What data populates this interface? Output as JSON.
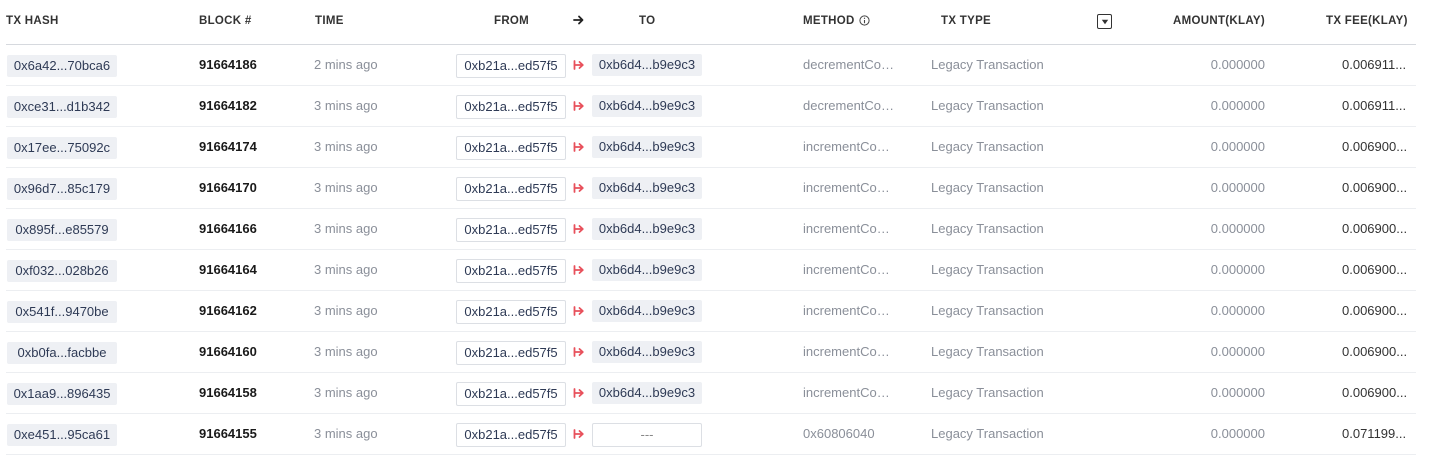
{
  "columns": {
    "tx_hash": "TX HASH",
    "block": "BLOCK #",
    "time": "TIME",
    "from": "FROM",
    "to": "TO",
    "method": "METHOD",
    "tx_type": "TX TYPE",
    "amount": "AMOUNT(KLAY)",
    "tx_fee": "TX FEE(KLAY)"
  },
  "icons": {
    "header_arrow": "arrow-right-icon",
    "method_info": "info-icon",
    "filter": "filter-dropdown-icon",
    "row_arrow": "transfer-arrow-icon"
  },
  "colors": {
    "row_arrow": "#e8505b",
    "chip_bg": "#eef0f4"
  },
  "rows": [
    {
      "hash": "0x6a42...70bca6",
      "block": "91664186",
      "time": "2 mins ago",
      "from": "0xb21a...ed57f5",
      "to": "0xb6d4...b9e9c3",
      "method": "decrementCounter",
      "tx_type": "Legacy Transaction",
      "amount": "0.000000",
      "fee": "0.006911..."
    },
    {
      "hash": "0xce31...d1b342",
      "block": "91664182",
      "time": "3 mins ago",
      "from": "0xb21a...ed57f5",
      "to": "0xb6d4...b9e9c3",
      "method": "decrementCounter",
      "tx_type": "Legacy Transaction",
      "amount": "0.000000",
      "fee": "0.006911..."
    },
    {
      "hash": "0x17ee...75092c",
      "block": "91664174",
      "time": "3 mins ago",
      "from": "0xb21a...ed57f5",
      "to": "0xb6d4...b9e9c3",
      "method": "incrementCounter",
      "tx_type": "Legacy Transaction",
      "amount": "0.000000",
      "fee": "0.006900..."
    },
    {
      "hash": "0x96d7...85c179",
      "block": "91664170",
      "time": "3 mins ago",
      "from": "0xb21a...ed57f5",
      "to": "0xb6d4...b9e9c3",
      "method": "incrementCounter",
      "tx_type": "Legacy Transaction",
      "amount": "0.000000",
      "fee": "0.006900..."
    },
    {
      "hash": "0x895f...e85579",
      "block": "91664166",
      "time": "3 mins ago",
      "from": "0xb21a...ed57f5",
      "to": "0xb6d4...b9e9c3",
      "method": "incrementCounter",
      "tx_type": "Legacy Transaction",
      "amount": "0.000000",
      "fee": "0.006900..."
    },
    {
      "hash": "0xf032...028b26",
      "block": "91664164",
      "time": "3 mins ago",
      "from": "0xb21a...ed57f5",
      "to": "0xb6d4...b9e9c3",
      "method": "incrementCounter",
      "tx_type": "Legacy Transaction",
      "amount": "0.000000",
      "fee": "0.006900..."
    },
    {
      "hash": "0x541f...9470be",
      "block": "91664162",
      "time": "3 mins ago",
      "from": "0xb21a...ed57f5",
      "to": "0xb6d4...b9e9c3",
      "method": "incrementCounter",
      "tx_type": "Legacy Transaction",
      "amount": "0.000000",
      "fee": "0.006900..."
    },
    {
      "hash": "0xb0fa...facbbe",
      "block": "91664160",
      "time": "3 mins ago",
      "from": "0xb21a...ed57f5",
      "to": "0xb6d4...b9e9c3",
      "method": "incrementCounter",
      "tx_type": "Legacy Transaction",
      "amount": "0.000000",
      "fee": "0.006900..."
    },
    {
      "hash": "0x1aa9...896435",
      "block": "91664158",
      "time": "3 mins ago",
      "from": "0xb21a...ed57f5",
      "to": "0xb6d4...b9e9c3",
      "method": "incrementCounter",
      "tx_type": "Legacy Transaction",
      "amount": "0.000000",
      "fee": "0.006900..."
    },
    {
      "hash": "0xe451...95ca61",
      "block": "91664155",
      "time": "3 mins ago",
      "from": "0xb21a...ed57f5",
      "to": "---",
      "method": "0x60806040",
      "tx_type": "Legacy Transaction",
      "amount": "0.000000",
      "fee": "0.071199..."
    }
  ]
}
